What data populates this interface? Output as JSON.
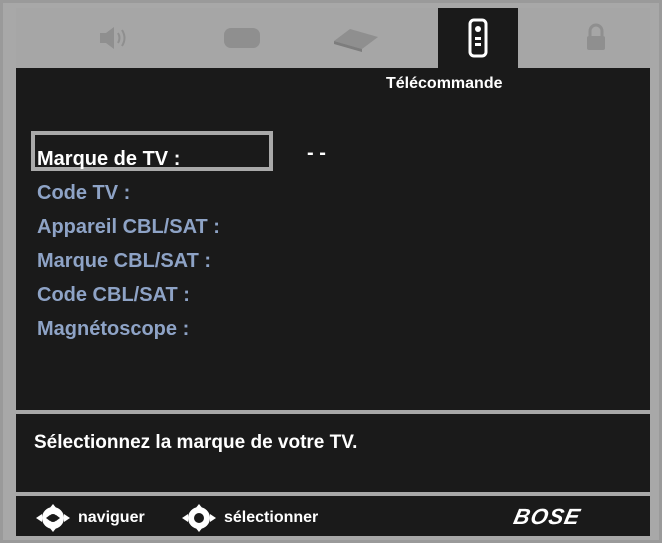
{
  "header": {
    "tabs": [
      {
        "icon": "speaker-icon",
        "active": false
      },
      {
        "icon": "screen-icon",
        "active": false
      },
      {
        "icon": "disc-player-icon",
        "active": false
      },
      {
        "icon": "remote-control-icon",
        "active": true
      },
      {
        "icon": "lock-icon",
        "active": false
      }
    ],
    "active_title": "Télécommande"
  },
  "menu": {
    "items": [
      {
        "label": "Marque de TV :",
        "selected": true
      },
      {
        "label": "Code TV :",
        "selected": false
      },
      {
        "label": "Appareil CBL/SAT :",
        "selected": false
      },
      {
        "label": "Marque CBL/SAT :",
        "selected": false
      },
      {
        "label": "Code CBL/SAT :",
        "selected": false
      },
      {
        "label": "Magnétoscope :",
        "selected": false
      }
    ],
    "selected_value": "- -"
  },
  "message": {
    "text": "Sélectionnez la marque de votre TV."
  },
  "footer": {
    "navigate_label": "naviguer",
    "select_label": "sélectionner",
    "brand": "BOSE"
  },
  "colors": {
    "background_panel": "#1a1a1a",
    "tab_bar": "#a6a6a6",
    "menu_text": "#8ea3c6",
    "selected_text": "#ffffff",
    "selection_border": "#a9a9a9"
  }
}
